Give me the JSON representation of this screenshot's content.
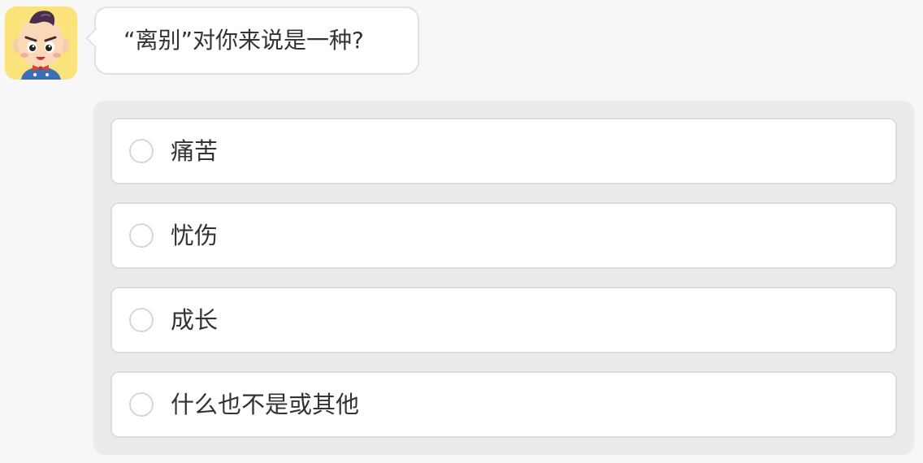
{
  "avatar": {
    "icon": "cartoon-boy-avatar-icon",
    "background_color": "#f9e37a"
  },
  "question": {
    "text": "“离别”对你来说是一种?"
  },
  "options": [
    {
      "label": "痛苦"
    },
    {
      "label": "忧伤"
    },
    {
      "label": "成长"
    },
    {
      "label": "什么也不是或其他"
    }
  ],
  "colors": {
    "page_background": "#f7f7f7",
    "panel_background": "#ebebeb",
    "option_background": "#ffffff",
    "border": "#dddddd",
    "text": "#333333"
  }
}
